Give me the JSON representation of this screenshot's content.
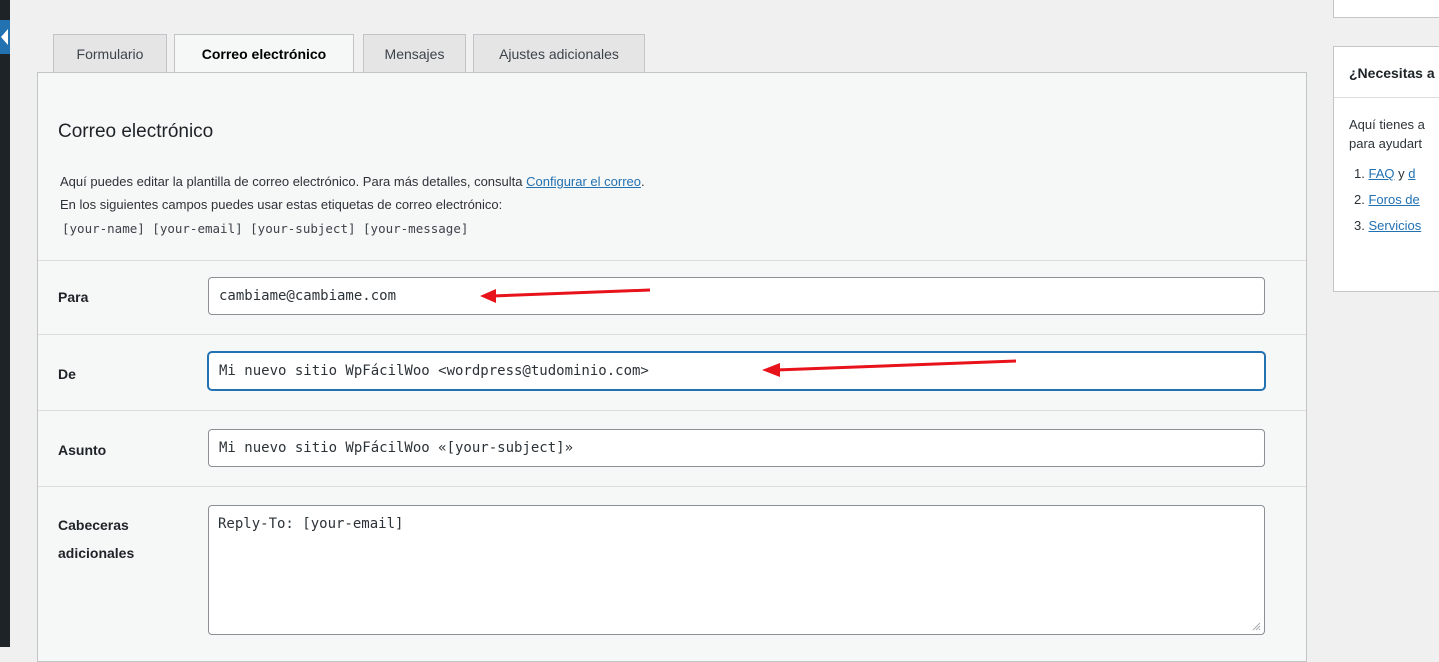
{
  "tabs": [
    {
      "label": "Formulario",
      "active": false
    },
    {
      "label": "Correo electrónico",
      "active": true
    },
    {
      "label": "Mensajes",
      "active": false
    },
    {
      "label": "Ajustes adicionales",
      "active": false
    }
  ],
  "section": {
    "title": "Correo electrónico",
    "desc_line1_prefix": "Aquí puedes editar la plantilla de correo electrónico. Para más detalles, consulta ",
    "desc_line1_link": "Configurar el correo",
    "desc_line1_suffix": ".",
    "desc_line2": "En los siguientes campos puedes usar estas etiquetas de correo electrónico:",
    "mail_tags": "[your-name] [your-email] [your-subject] [your-message]"
  },
  "fields": {
    "to": {
      "label": "Para",
      "value": "cambiame@cambiame.com"
    },
    "from": {
      "label": "De",
      "value": "Mi nuevo sitio WpFácilWoo <wordpress@tudominio.com>"
    },
    "subject": {
      "label": "Asunto",
      "value": "Mi nuevo sitio WpFácilWoo «[your-subject]»"
    },
    "headers": {
      "label_line1": "Cabeceras",
      "label_line2": "adicionales",
      "value": "Reply-To: [your-email]"
    }
  },
  "sidebar_box": {
    "title": "¿Necesitas a",
    "text_line1": "Aquí tienes a",
    "text_line2": "para ayudart",
    "items": [
      {
        "num": "1.",
        "link": "FAQ",
        "rest": " y ",
        "link2": "d"
      },
      {
        "num": "2.",
        "link": "Foros de"
      },
      {
        "num": "3.",
        "link": "Servicios"
      }
    ]
  },
  "colors": {
    "accent": "#2271b1",
    "annotation_arrow": "#e8121a",
    "admin_bar": "#1d2327"
  }
}
